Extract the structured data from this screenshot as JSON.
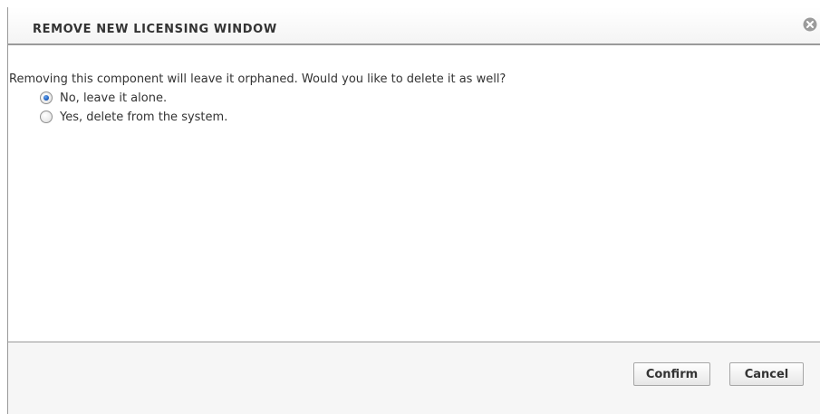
{
  "dialog": {
    "title": "REMOVE NEW LICENSING WINDOW",
    "close_icon": "close-circle-icon"
  },
  "body": {
    "message": "Removing this component will leave it orphaned. Would you like to delete it as well?",
    "options": [
      {
        "label": "No, leave it alone.",
        "checked": true
      },
      {
        "label": "Yes, delete from the system.",
        "checked": false
      }
    ]
  },
  "footer": {
    "confirm_label": "Confirm",
    "cancel_label": "Cancel"
  },
  "colors": {
    "border": "#9a9a9a",
    "text": "#333333",
    "radio_selected": "#1f5fbf"
  }
}
